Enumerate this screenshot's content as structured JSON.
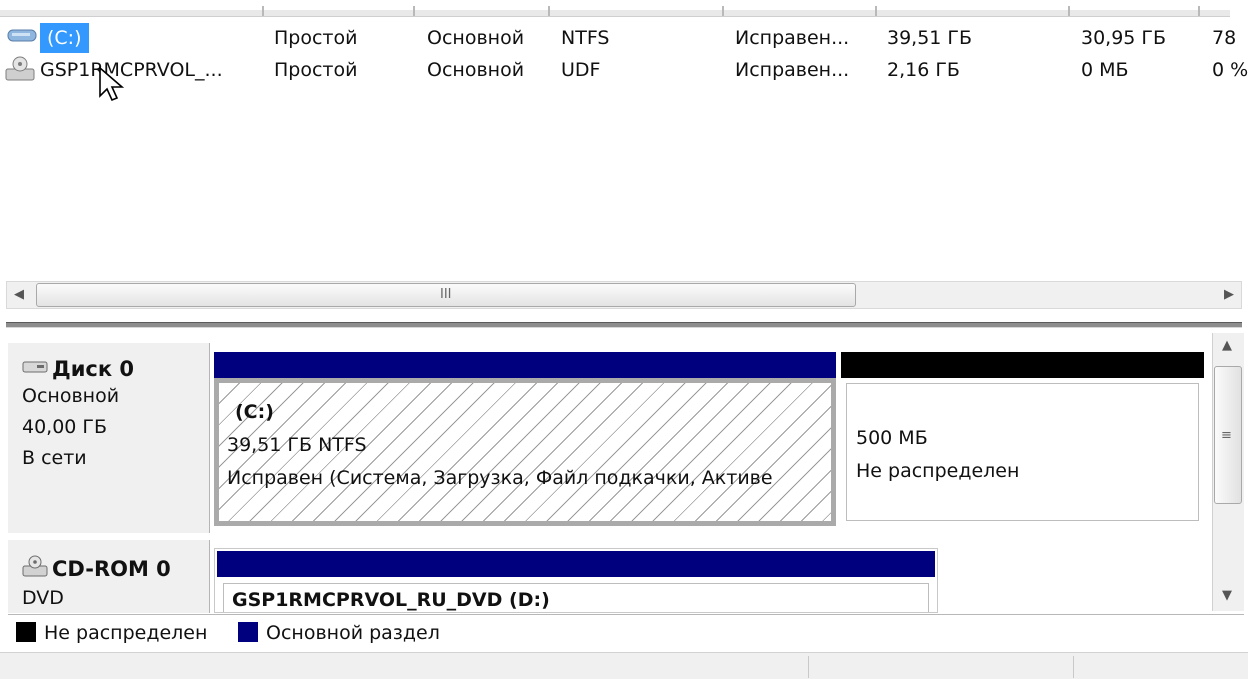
{
  "volumes": [
    {
      "icon": "drive-icon",
      "name": "(C:)",
      "layout": "Простой",
      "type": "Основной",
      "fs": "NTFS",
      "status": "Исправен...",
      "capacity": "39,51 ГБ",
      "free": "30,95 ГБ",
      "pct": "78"
    },
    {
      "icon": "cd-drive-icon",
      "name": "GSP1RMCPRVOL_...",
      "layout": "Простой",
      "type": "Основной",
      "fs": "UDF",
      "status": "Исправен...",
      "capacity": "2,16 ГБ",
      "free": "0 МБ",
      "pct": "0 %"
    }
  ],
  "hscroll": {
    "grip": "III"
  },
  "disks": [
    {
      "name": "Диск 0",
      "kind": "Основной",
      "size": "40,00 ГБ",
      "state": "В сети",
      "partitions": [
        {
          "title": "(C:)",
          "line1": "39,51 ГБ NTFS",
          "line2": "Исправен (Система, Загрузка, Файл подкачки, Активе"
        },
        {
          "title": "",
          "line1": "500 МБ",
          "line2": "Не распределен"
        }
      ]
    },
    {
      "name": "CD-ROM 0",
      "kind": "DVD",
      "partitions": [
        {
          "title": "GSP1RMCPRVOL_RU_DVD  (D:)"
        }
      ]
    }
  ],
  "legend": [
    {
      "label": "Не распределен",
      "color": "#000000"
    },
    {
      "label": "Основной раздел",
      "color": "#00007f"
    }
  ],
  "colors": {
    "primary_partition": "#00007f",
    "unallocated": "#000000",
    "selection": "#3399ff"
  }
}
